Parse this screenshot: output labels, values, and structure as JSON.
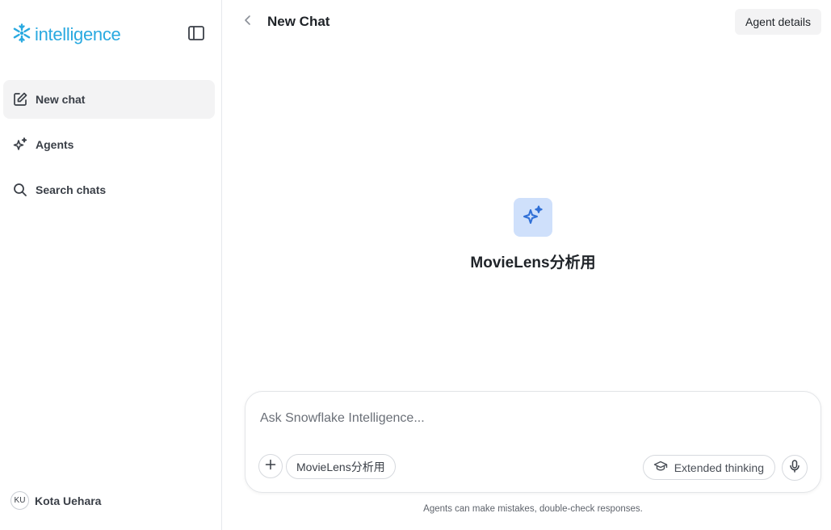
{
  "sidebar": {
    "brand": {
      "name": "intelligence",
      "logo_icon": "snowflake-icon",
      "color": "#29a9e0"
    },
    "toggle_icon": "sidebar-panel-icon",
    "items": [
      {
        "label": "New chat",
        "icon": "edit-icon",
        "active": true
      },
      {
        "label": "Agents",
        "icon": "sparkle-icon",
        "active": false
      },
      {
        "label": "Search chats",
        "icon": "search-icon",
        "active": false
      }
    ],
    "user": {
      "initials": "KU",
      "name": "Kota Uehara"
    }
  },
  "header": {
    "back_icon": "chevron-left-icon",
    "title": "New Chat",
    "agent_details_label": "Agent details"
  },
  "hero": {
    "icon": "sparkles-icon",
    "icon_bg": "#cfe0fb",
    "icon_color": "#2f6fd6",
    "agent_name": "MovieLens分析用"
  },
  "composer": {
    "placeholder": "Ask Snowflake Intelligence...",
    "value": "",
    "add_icon": "plus-icon",
    "agent_chip": "MovieLens分析用",
    "extended_thinking_label": "Extended thinking",
    "extended_thinking_icon": "graduation-cap-icon",
    "mic_icon": "microphone-icon"
  },
  "footer": {
    "disclaimer": "Agents can make mistakes, double-check responses."
  }
}
